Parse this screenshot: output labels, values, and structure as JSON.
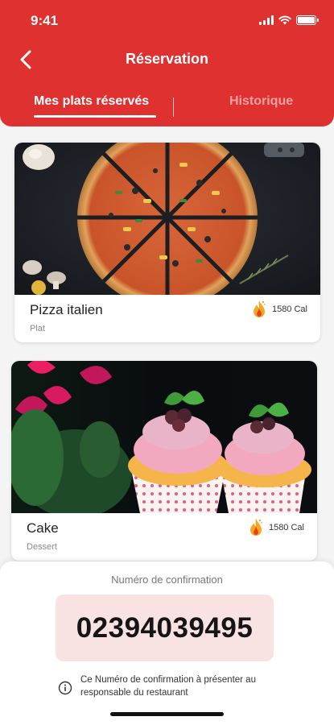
{
  "status_bar": {
    "time": "9:41"
  },
  "header": {
    "title": "Réservation",
    "tabs": [
      {
        "label": "Mes plats réservés",
        "active": true
      },
      {
        "label": "Historique",
        "active": false
      }
    ]
  },
  "reservations": [
    {
      "name": "Pizza italien",
      "category": "Plat",
      "calories": "1580 Cal"
    },
    {
      "name": "Cake",
      "category": "Dessert",
      "calories": "1580 Cal"
    }
  ],
  "confirmation": {
    "label": "Numéro de confirmation",
    "number": "02394039495",
    "note": "Ce Numéro de confirmation à présenter au responsable du restaurant"
  },
  "colors": {
    "primary": "#e03131",
    "confirmation_bg": "#f9e2e2"
  },
  "icons": [
    "chevron-left-icon",
    "fire-icon",
    "info-icon",
    "signal-icon",
    "wifi-icon",
    "battery-icon"
  ]
}
